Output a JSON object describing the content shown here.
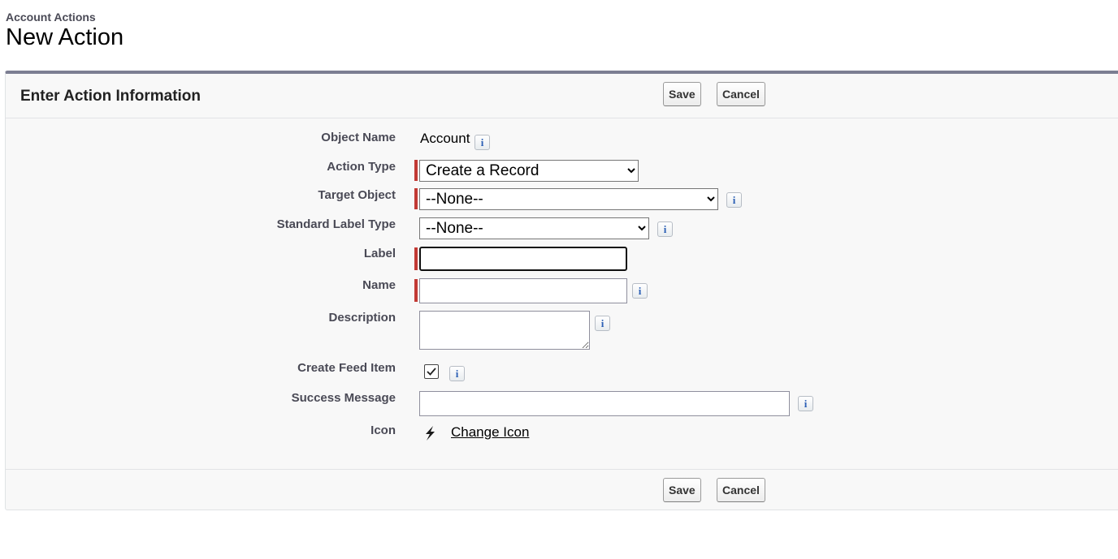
{
  "header": {
    "breadcrumb": "Account Actions",
    "title": "New Action"
  },
  "section": {
    "title": "Enter Action Information",
    "save_label": "Save",
    "cancel_label": "Cancel"
  },
  "fields": {
    "object_name": {
      "label": "Object Name",
      "value": "Account"
    },
    "action_type": {
      "label": "Action Type",
      "value": "Create a Record"
    },
    "target_object": {
      "label": "Target Object",
      "value": "--None--"
    },
    "standard_label_type": {
      "label": "Standard Label Type",
      "value": "--None--"
    },
    "label": {
      "label": "Label",
      "value": ""
    },
    "name": {
      "label": "Name",
      "value": ""
    },
    "description": {
      "label": "Description",
      "value": ""
    },
    "create_feed_item": {
      "label": "Create Feed Item",
      "checked": true
    },
    "success_message": {
      "label": "Success Message",
      "value": ""
    },
    "icon": {
      "label": "Icon",
      "icon_name": "lightning-bolt-icon",
      "change_link": "Change Icon"
    }
  },
  "colors": {
    "required_marker": "#c23934",
    "panel_accent": "#7c7e92",
    "info_icon": "#2b5fb5"
  }
}
